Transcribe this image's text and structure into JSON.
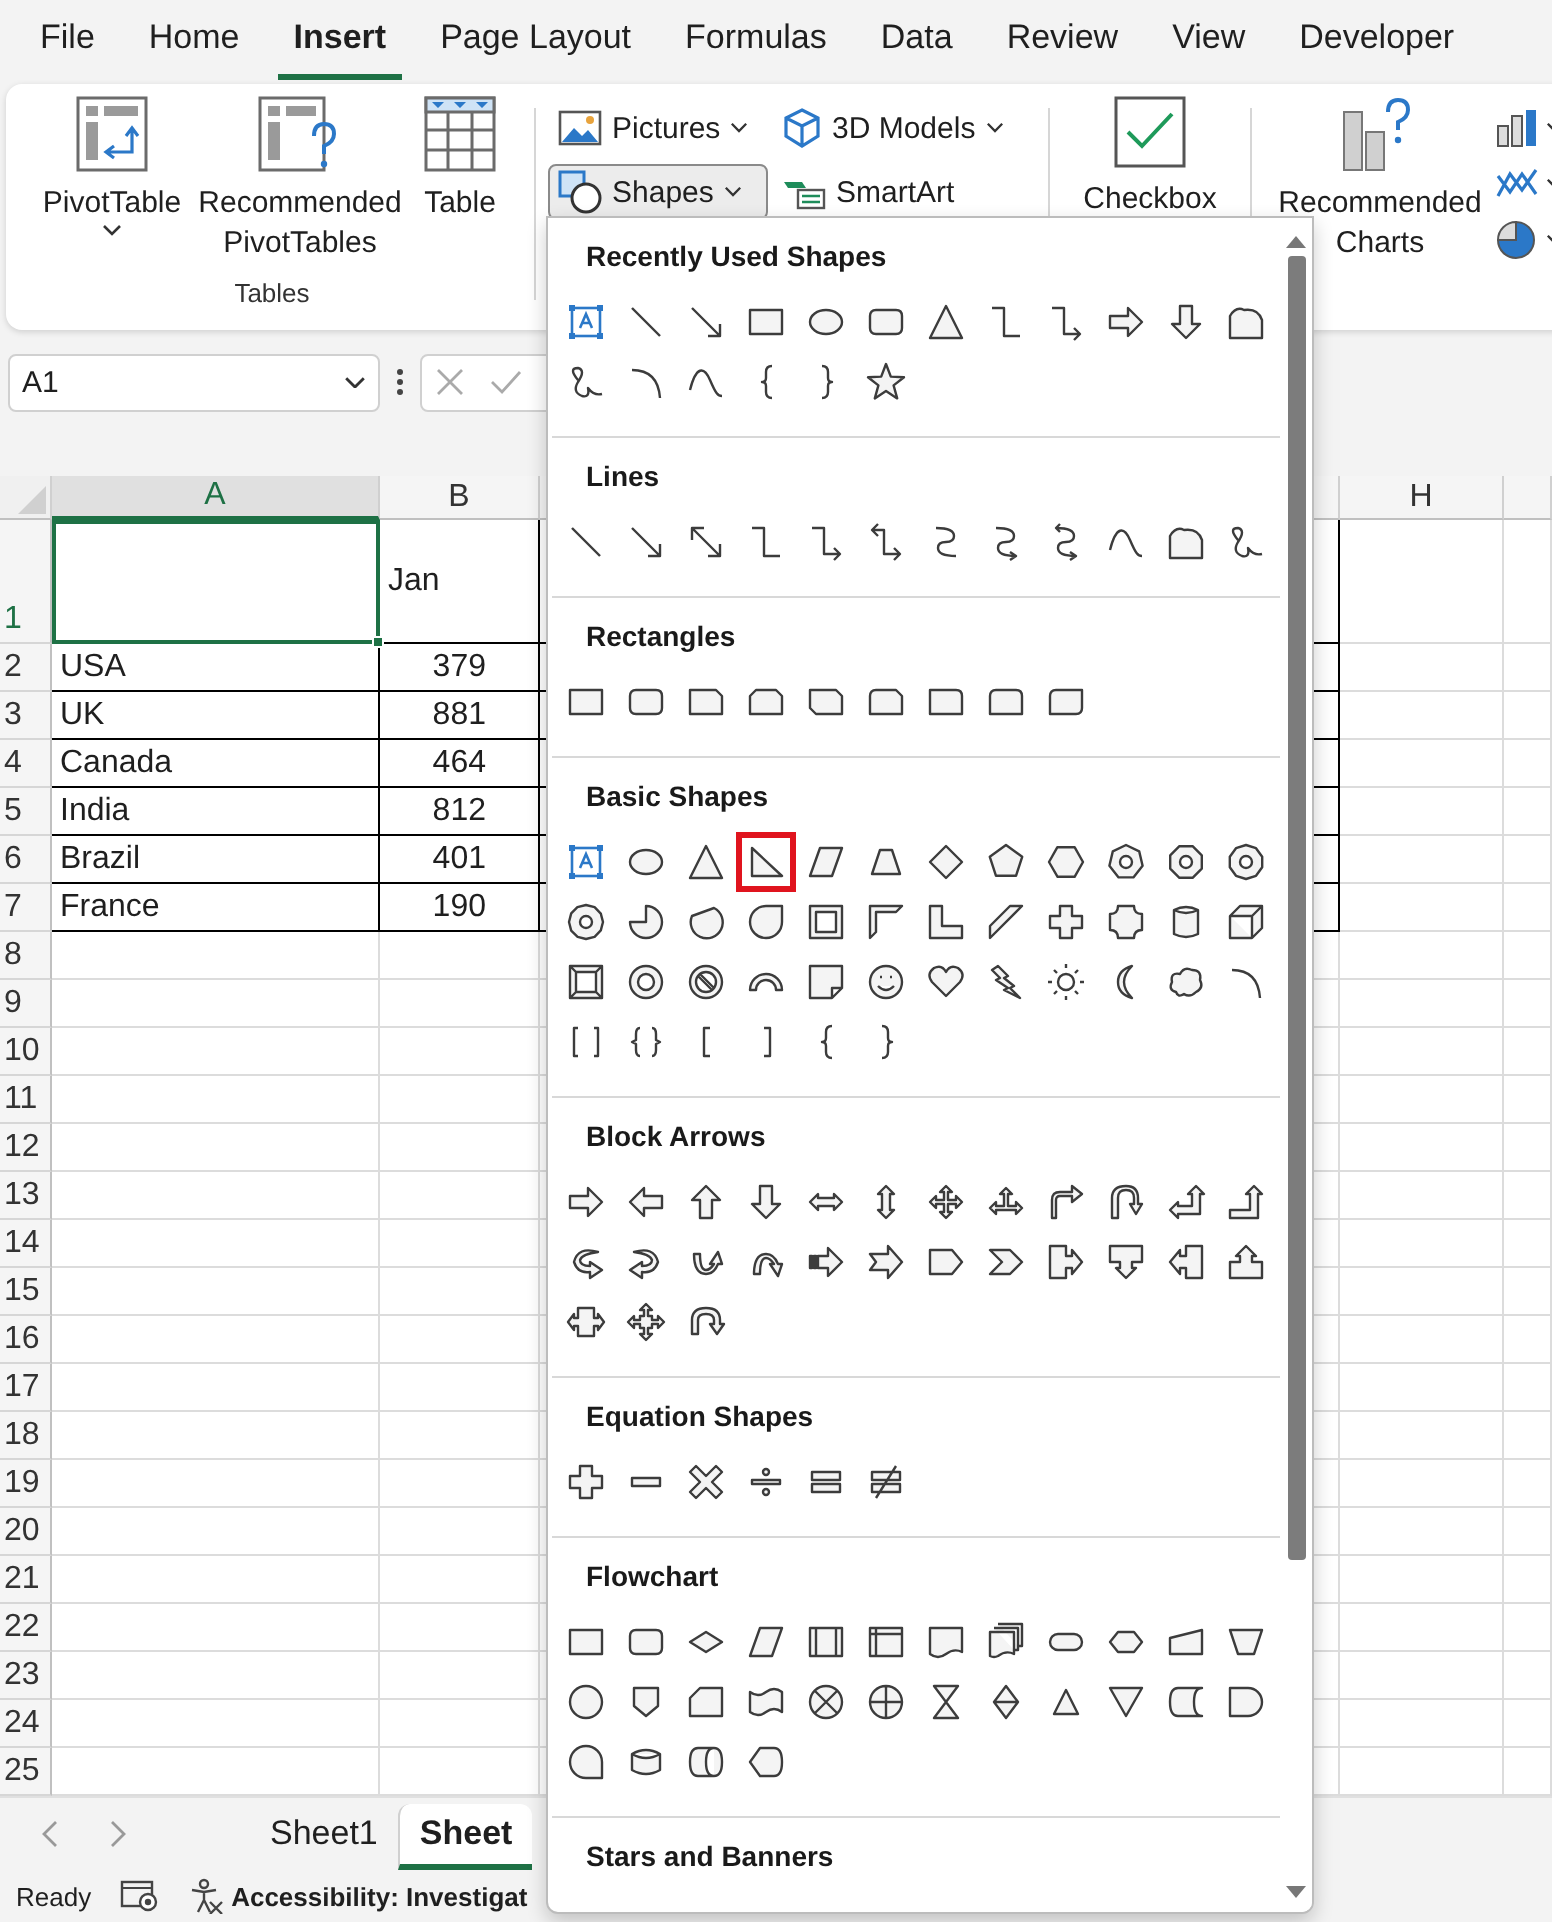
{
  "ribbon_tabs": [
    {
      "label": "File",
      "selected": false
    },
    {
      "label": "Home",
      "selected": false
    },
    {
      "label": "Insert",
      "selected": true
    },
    {
      "label": "Page Layout",
      "selected": false
    },
    {
      "label": "Formulas",
      "selected": false
    },
    {
      "label": "Data",
      "selected": false
    },
    {
      "label": "Review",
      "selected": false
    },
    {
      "label": "View",
      "selected": false
    },
    {
      "label": "Developer",
      "selected": false
    }
  ],
  "ribbon": {
    "tables_group": {
      "label": "Tables",
      "commands": [
        {
          "label": "PivotTable",
          "dropdown": true
        },
        {
          "label": "Recommended PivotTables",
          "dropdown": false
        },
        {
          "label": "Table",
          "dropdown": false
        }
      ]
    },
    "illustrations": [
      {
        "label": "Pictures",
        "dropdown": true,
        "pressed": false
      },
      {
        "label": "3D Models",
        "dropdown": true,
        "pressed": false
      },
      {
        "label": "Shapes",
        "dropdown": true,
        "pressed": true
      },
      {
        "label": "SmartArt",
        "dropdown": false,
        "pressed": false
      }
    ],
    "checkbox": {
      "label": "Checkbox"
    },
    "charts": {
      "label": "Recommended Charts"
    }
  },
  "formula_bar": {
    "name_box": "A1"
  },
  "grid": {
    "columns": [
      {
        "label": "A",
        "selected": true
      },
      {
        "label": "B",
        "selected": false
      },
      {
        "label": "H",
        "selected": false
      }
    ],
    "rows": [
      {
        "label": "1",
        "selected": true
      },
      {
        "label": "2",
        "selected": false
      },
      {
        "label": "3",
        "selected": false
      },
      {
        "label": "4",
        "selected": false
      },
      {
        "label": "5",
        "selected": false
      },
      {
        "label": "6",
        "selected": false
      },
      {
        "label": "7",
        "selected": false
      },
      {
        "label": "8",
        "selected": false
      },
      {
        "label": "9",
        "selected": false
      },
      {
        "label": "10",
        "selected": false
      },
      {
        "label": "11",
        "selected": false
      },
      {
        "label": "12",
        "selected": false
      },
      {
        "label": "13",
        "selected": false
      },
      {
        "label": "14",
        "selected": false
      },
      {
        "label": "15",
        "selected": false
      },
      {
        "label": "16",
        "selected": false
      },
      {
        "label": "17",
        "selected": false
      },
      {
        "label": "18",
        "selected": false
      },
      {
        "label": "19",
        "selected": false
      },
      {
        "label": "20",
        "selected": false
      },
      {
        "label": "21",
        "selected": false
      },
      {
        "label": "22",
        "selected": false
      },
      {
        "label": "23",
        "selected": false
      },
      {
        "label": "24",
        "selected": false
      },
      {
        "label": "25",
        "selected": false
      }
    ],
    "table": {
      "header": "Jan",
      "rows": [
        [
          "USA",
          "379"
        ],
        [
          "UK",
          "881"
        ],
        [
          "Canada",
          "464"
        ],
        [
          "India",
          "812"
        ],
        [
          "Brazil",
          "401"
        ],
        [
          "France",
          "190"
        ]
      ]
    }
  },
  "shapes_menu": {
    "sections": [
      {
        "title": "Recently Used Shapes",
        "shapes": [
          {
            "selected": false
          },
          {
            "selected": false
          },
          {
            "selected": false
          },
          {
            "selected": false
          },
          {
            "selected": false
          },
          {
            "selected": false
          },
          {
            "selected": false
          },
          {
            "selected": false
          },
          {
            "selected": false
          },
          {
            "selected": false
          },
          {
            "selected": false
          },
          {
            "selected": false
          },
          {
            "selected": false
          },
          {
            "selected": false
          },
          {
            "selected": false
          },
          {
            "selected": false
          },
          {
            "selected": false
          },
          {
            "selected": false
          }
        ]
      },
      {
        "title": "Lines",
        "shapes": [
          {
            "selected": false
          },
          {
            "selected": false
          },
          {
            "selected": false
          },
          {
            "selected": false
          },
          {
            "selected": false
          },
          {
            "selected": false
          },
          {
            "selected": false
          },
          {
            "selected": false
          },
          {
            "selected": false
          },
          {
            "selected": false
          },
          {
            "selected": false
          },
          {
            "selected": false
          }
        ]
      },
      {
        "title": "Rectangles",
        "shapes": [
          {
            "selected": false
          },
          {
            "selected": false
          },
          {
            "selected": false
          },
          {
            "selected": false
          },
          {
            "selected": false
          },
          {
            "selected": false
          },
          {
            "selected": false
          },
          {
            "selected": false
          },
          {
            "selected": false
          }
        ]
      },
      {
        "title": "Basic Shapes",
        "shapes": [
          {
            "selected": false
          },
          {
            "selected": false
          },
          {
            "selected": false
          },
          {
            "selected": true
          },
          {
            "selected": false
          },
          {
            "selected": false
          },
          {
            "selected": false
          },
          {
            "selected": false
          },
          {
            "selected": false
          },
          {
            "selected": false
          },
          {
            "selected": false
          },
          {
            "selected": false
          },
          {
            "selected": false
          },
          {
            "selected": false
          },
          {
            "selected": false
          },
          {
            "selected": false
          },
          {
            "selected": false
          },
          {
            "selected": false
          },
          {
            "selected": false
          },
          {
            "selected": false
          },
          {
            "selected": false
          },
          {
            "selected": false
          },
          {
            "selected": false
          },
          {
            "selected": false
          },
          {
            "selected": false
          },
          {
            "selected": false
          },
          {
            "selected": false
          },
          {
            "selected": false
          },
          {
            "selected": false
          },
          {
            "selected": false
          },
          {
            "selected": false
          },
          {
            "selected": false
          },
          {
            "selected": false
          },
          {
            "selected": false
          },
          {
            "selected": false
          },
          {
            "selected": false
          },
          {
            "selected": false
          },
          {
            "selected": false
          },
          {
            "selected": false
          },
          {
            "selected": false
          },
          {
            "selected": false
          },
          {
            "selected": false
          }
        ]
      },
      {
        "title": "Block Arrows",
        "shapes": [
          {
            "selected": false
          },
          {
            "selected": false
          },
          {
            "selected": false
          },
          {
            "selected": false
          },
          {
            "selected": false
          },
          {
            "selected": false
          },
          {
            "selected": false
          },
          {
            "selected": false
          },
          {
            "selected": false
          },
          {
            "selected": false
          },
          {
            "selected": false
          },
          {
            "selected": false
          },
          {
            "selected": false
          },
          {
            "selected": false
          },
          {
            "selected": false
          },
          {
            "selected": false
          },
          {
            "selected": false
          },
          {
            "selected": false
          },
          {
            "selected": false
          },
          {
            "selected": false
          },
          {
            "selected": false
          },
          {
            "selected": false
          },
          {
            "selected": false
          },
          {
            "selected": false
          },
          {
            "selected": false
          },
          {
            "selected": false
          },
          {
            "selected": false
          }
        ]
      },
      {
        "title": "Equation Shapes",
        "shapes": [
          {
            "selected": false
          },
          {
            "selected": false
          },
          {
            "selected": false
          },
          {
            "selected": false
          },
          {
            "selected": false
          },
          {
            "selected": false
          }
        ]
      },
      {
        "title": "Flowchart",
        "shapes": [
          {
            "selected": false
          },
          {
            "selected": false
          },
          {
            "selected": false
          },
          {
            "selected": false
          },
          {
            "selected": false
          },
          {
            "selected": false
          },
          {
            "selected": false
          },
          {
            "selected": false
          },
          {
            "selected": false
          },
          {
            "selected": false
          },
          {
            "selected": false
          },
          {
            "selected": false
          },
          {
            "selected": false
          },
          {
            "selected": false
          },
          {
            "selected": false
          },
          {
            "selected": false
          },
          {
            "selected": false
          },
          {
            "selected": false
          },
          {
            "selected": false
          },
          {
            "selected": false
          },
          {
            "selected": false
          },
          {
            "selected": false
          },
          {
            "selected": false
          },
          {
            "selected": false
          },
          {
            "selected": false
          },
          {
            "selected": false
          },
          {
            "selected": false
          },
          {
            "selected": false
          }
        ]
      },
      {
        "title": "Stars and Banners"
      }
    ]
  },
  "sheet_tabs": [
    {
      "label": "Sheet1",
      "selected": false
    },
    {
      "label": "Sheet",
      "selected": true
    }
  ],
  "status_bar": {
    "mode": "Ready",
    "accessibility": "Accessibility: Investigat"
  }
}
